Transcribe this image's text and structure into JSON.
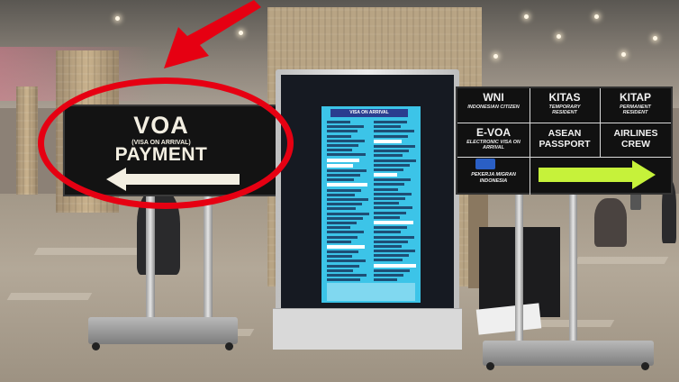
{
  "voa_sign": {
    "title": "VOA",
    "subtitle": "(VISA ON ARRIVAL)",
    "payment": "PAYMENT"
  },
  "kiosk_screen": {
    "title": "VISA ON ARRIVAL"
  },
  "right_sign": {
    "wni": {
      "title": "WNI",
      "subtitle": "INDONESIAN CITIZEN"
    },
    "kitas": {
      "title": "KITAS",
      "subtitle": "TEMPORARY RESIDENT"
    },
    "kitap": {
      "title": "KITAP",
      "subtitle": "PERMANENT RESIDENT"
    },
    "evoa": {
      "title": "E-VOA",
      "subtitle": "ELECTRONIC VISA ON ARRIVAL"
    },
    "asean": {
      "title": "ASEAN PASSPORT"
    },
    "airlines": {
      "title": "AIRLINES CREW"
    },
    "migrant": {
      "title": "PEKERJA MIGRAN INDONESIA"
    }
  },
  "colors": {
    "annotation_red": "#e60012",
    "arrow_green": "#c6f23a",
    "screen_cyan": "#3cc4e8",
    "sign_black": "#111111"
  }
}
